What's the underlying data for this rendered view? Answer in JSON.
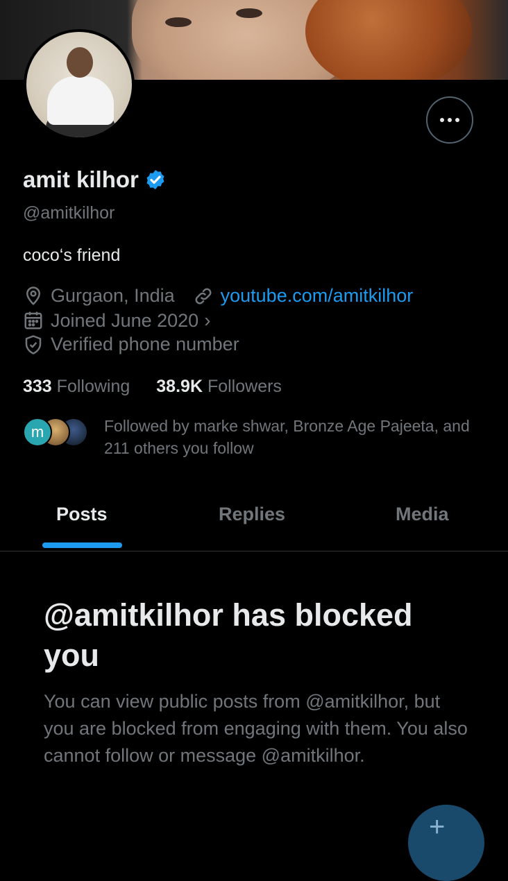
{
  "profile": {
    "name": "amit kilhor",
    "handle": "@amitkilhor",
    "bio": "coco‘s friend",
    "location": "Gurgaon, India",
    "website": "youtube.com/amitkilhor",
    "joined": "Joined June 2020",
    "verified_phone": "Verified phone number",
    "verified_badge_color": "#1d9bf0"
  },
  "stats": {
    "following_count": "333",
    "following_label": "Following",
    "followers_count": "38.9K",
    "followers_label": "Followers"
  },
  "followed_by": {
    "first_avatar_letter": "m",
    "text": "Followed by marke shwar, Bronze Age Pajeeta, and 211 others you follow"
  },
  "tabs": [
    {
      "label": "Posts",
      "active": true
    },
    {
      "label": "Replies",
      "active": false
    },
    {
      "label": "Media",
      "active": false
    }
  ],
  "blocked": {
    "title": "@amitkilhor has blocked you",
    "description": "You can view public posts from @amitkilhor, but you are blocked from engaging with them. You also cannot follow or message @amitkilhor."
  },
  "icons": {
    "location": "location-pin-icon",
    "link": "link-icon",
    "calendar": "calendar-icon",
    "shield": "shield-check-icon",
    "more": "more-dots-icon",
    "verified": "verified-badge-icon"
  },
  "colors": {
    "background": "#000000",
    "text_primary": "#e7e9ea",
    "text_secondary": "#71767b",
    "accent": "#1d9bf0"
  }
}
